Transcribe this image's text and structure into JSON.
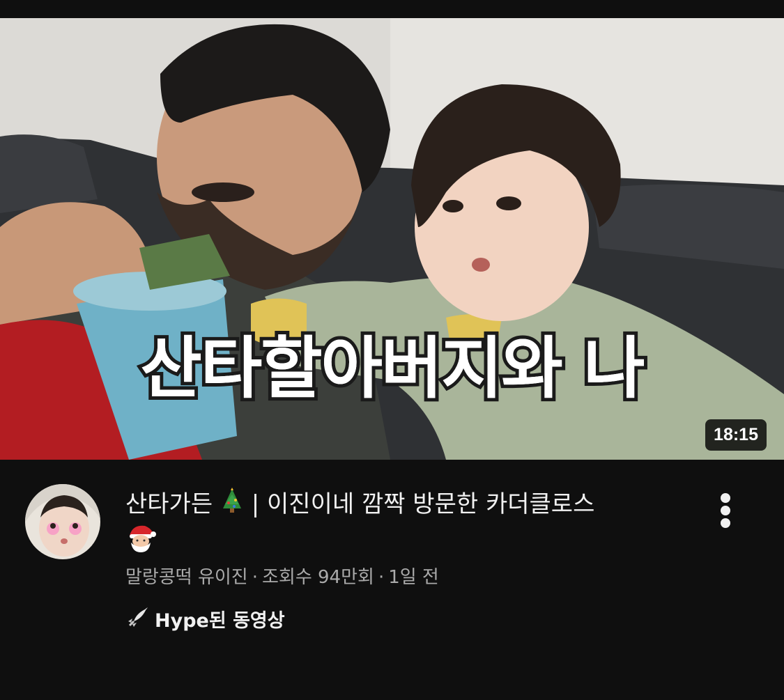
{
  "video": {
    "overlay_text": "산타할아버지와 나",
    "duration": "18:15",
    "title_part1": "산타가든",
    "title_part2": "|  이진이네 깜짝 방문한 카더클로스",
    "channel": "말랑콩떡 유이진",
    "views": "조회수 94만회",
    "age": "1일 전",
    "hype_label": "Hype된 동영상"
  },
  "icons": {
    "title_emoji_1": "christmas-tree-icon",
    "title_emoji_2": "santa-icon",
    "hype": "rocket-icon",
    "more": "more-vertical-icon"
  },
  "colors": {
    "background": "#0f0f0f",
    "primary_text": "#f1f1f1",
    "secondary_text": "#aaaaaa"
  }
}
